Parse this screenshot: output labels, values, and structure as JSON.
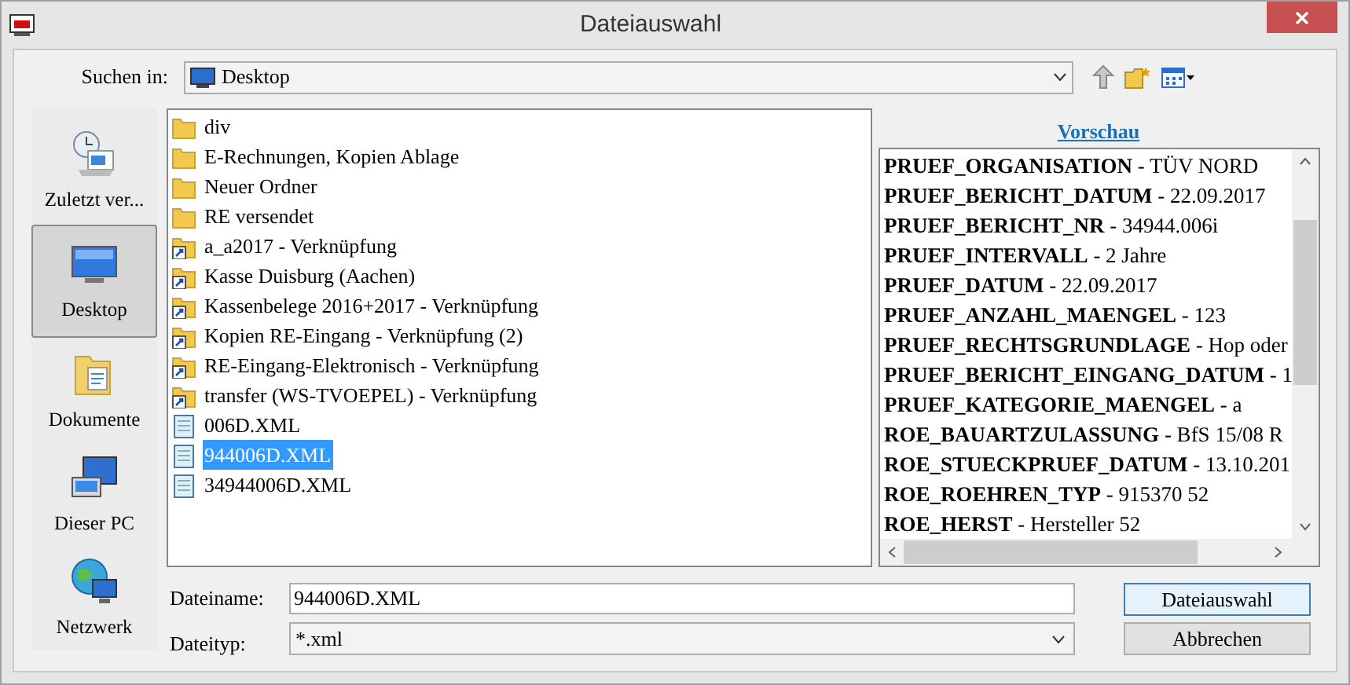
{
  "window": {
    "title": "Dateiauswahl"
  },
  "look_in": {
    "label": "Suchen in:",
    "value": "Desktop"
  },
  "places": [
    {
      "label": "Zuletzt ver...",
      "kind": "recent",
      "selected": false
    },
    {
      "label": "Desktop",
      "kind": "desktop",
      "selected": true
    },
    {
      "label": "Dokumente",
      "kind": "documents",
      "selected": false
    },
    {
      "label": "Dieser PC",
      "kind": "pc",
      "selected": false
    },
    {
      "label": "Netzwerk",
      "kind": "network",
      "selected": false
    }
  ],
  "files": [
    {
      "name": "div",
      "kind": "folder",
      "selected": false
    },
    {
      "name": "E-Rechnungen, Kopien Ablage",
      "kind": "folder",
      "selected": false
    },
    {
      "name": "Neuer Ordner",
      "kind": "folder",
      "selected": false
    },
    {
      "name": "RE versendet",
      "kind": "folder",
      "selected": false
    },
    {
      "name": "a_a2017 - Verknüpfung",
      "kind": "shortcut",
      "selected": false
    },
    {
      "name": "Kasse Duisburg (Aachen)",
      "kind": "shortcut",
      "selected": false
    },
    {
      "name": "Kassenbelege 2016+2017 - Verknüpfung",
      "kind": "shortcut",
      "selected": false
    },
    {
      "name": "Kopien RE-Eingang - Verknüpfung (2)",
      "kind": "shortcut",
      "selected": false
    },
    {
      "name": "RE-Eingang-Elektronisch - Verknüpfung",
      "kind": "shortcut",
      "selected": false
    },
    {
      "name": "transfer (WS-TVOEPEL) - Verknüpfung",
      "kind": "shortcut",
      "selected": false
    },
    {
      "name": "006D.XML",
      "kind": "file",
      "selected": false
    },
    {
      "name": "944006D.XML",
      "kind": "file",
      "selected": true
    },
    {
      "name": "34944006D.XML",
      "kind": "file",
      "selected": false
    }
  ],
  "preview": {
    "title": "Vorschau",
    "lines": [
      "**PRUEF_ORGANISATION** - TÜV NORD",
      "**PRUEF_BERICHT_DATUM** - 22.09.2017",
      "**PRUEF_BERICHT_NR** - 34944.006i",
      "**PRUEF_INTERVALL** - 2 Jahre",
      "**PRUEF_DATUM** - 22.09.2017",
      "**PRUEF_ANZAHL_MAENGEL** - 123",
      "**PRUEF_RECHTSGRUNDLAGE** - Hop oder",
      "**PRUEF_BERICHT_EINGANG_DATUM** - 1",
      "**PRUEF_KATEGORIE_MAENGEL** - a",
      "**ROE_BAUARTZULASSUNG** - BfS 15/08 R",
      "**ROE_STUECKPRUEF_DATUM** - 13.10.201",
      "**ROE_ROEHREN_TYP** - 915370 52",
      "**ROE_HERST** - Hersteller 52"
    ]
  },
  "filename": {
    "label": "Dateiname:",
    "value": "944006D.XML"
  },
  "filetype": {
    "label": "Dateityp:",
    "value": "*.xml"
  },
  "buttons": [
    "Dateiauswahl",
    "Abbrechen"
  ]
}
